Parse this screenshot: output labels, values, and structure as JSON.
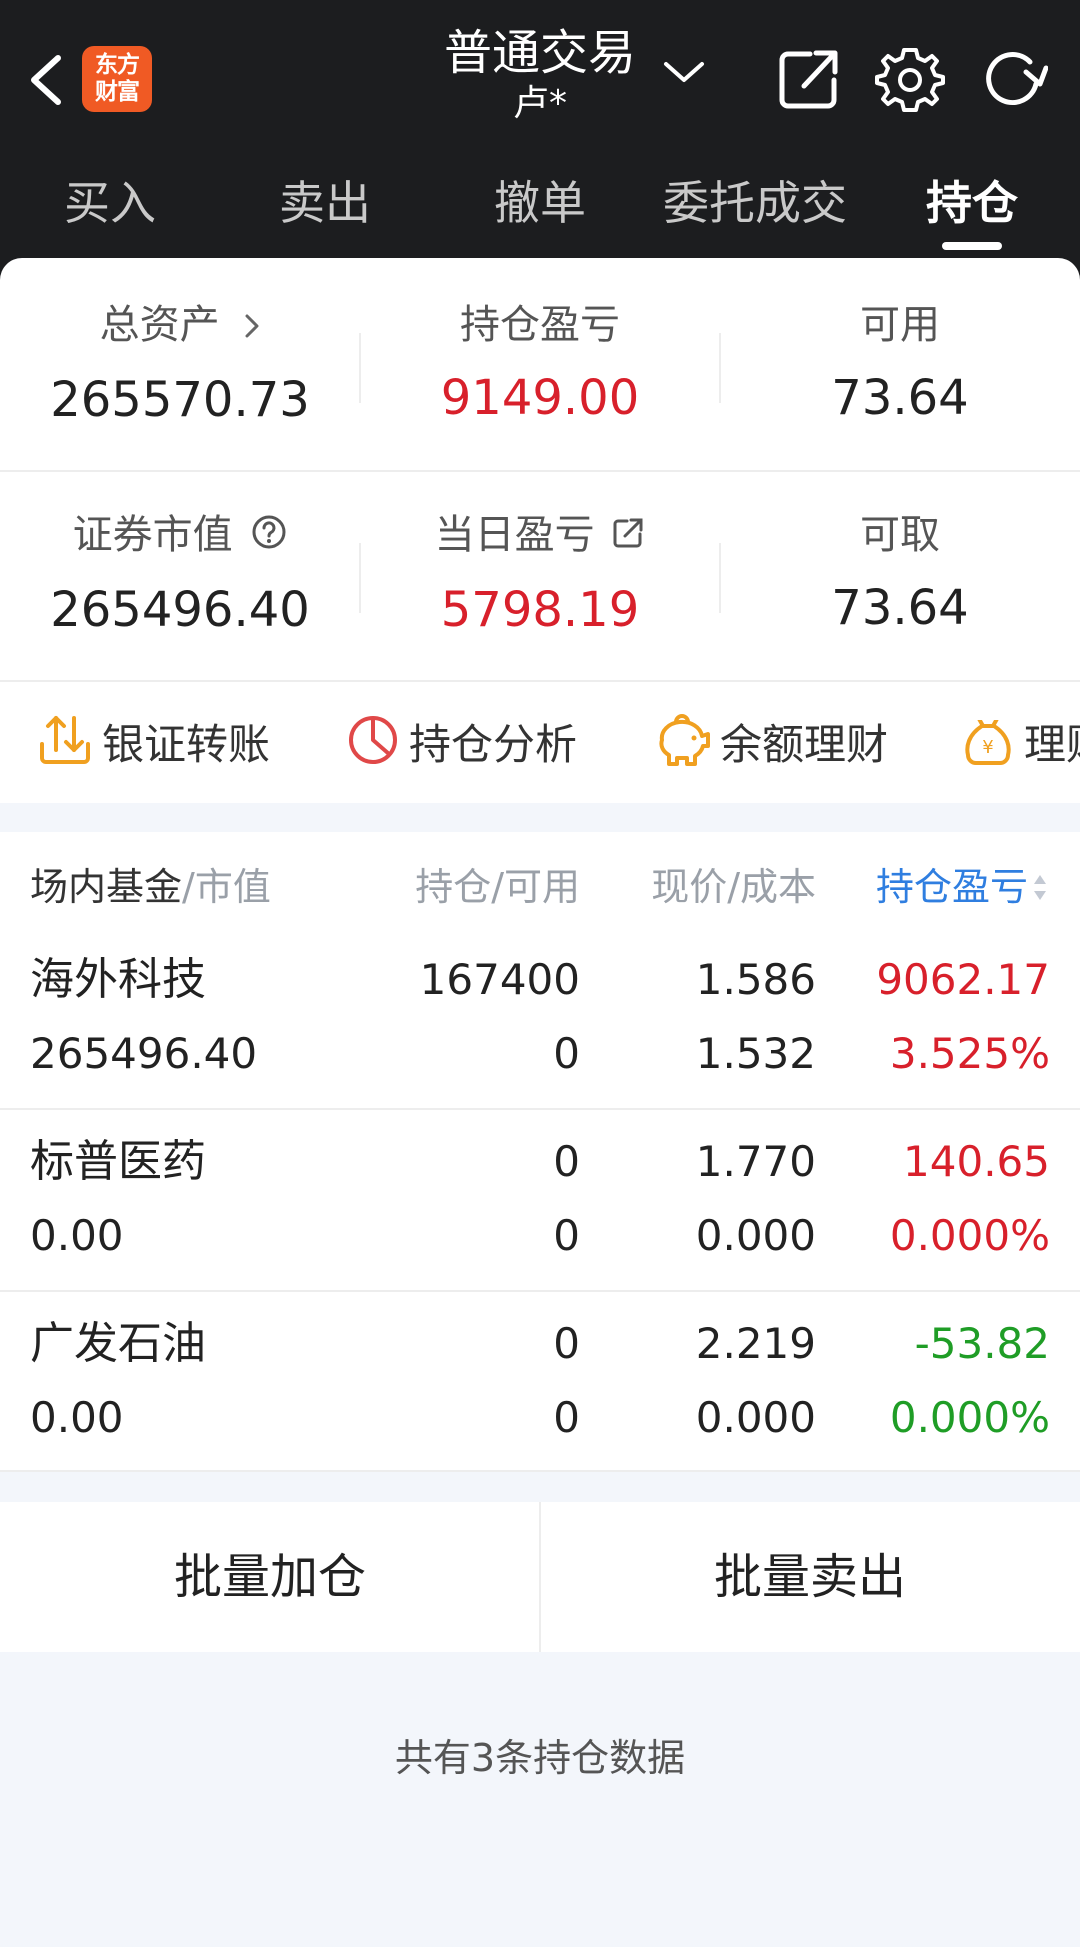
{
  "header": {
    "logo_text_line1": "东方",
    "logo_text_line2": "财富",
    "title": "普通交易",
    "subtitle": "卢*",
    "icons": [
      "back-arrow-icon",
      "share-external-icon",
      "gear-icon",
      "refresh-icon",
      "chevron-down-icon"
    ]
  },
  "tabs": [
    {
      "label": "买入",
      "active": false
    },
    {
      "label": "卖出",
      "active": false
    },
    {
      "label": "撤单",
      "active": false
    },
    {
      "label": "委托成交",
      "active": false
    },
    {
      "label": "持仓",
      "active": true
    }
  ],
  "summary": {
    "total_assets": {
      "label": "总资产",
      "value": "265570.73"
    },
    "position_pnl": {
      "label": "持仓盈亏",
      "value": "9149.00"
    },
    "available": {
      "label": "可用",
      "value": "73.64"
    },
    "market_value": {
      "label": "证券市值",
      "value": "265496.40"
    },
    "daily_pnl": {
      "label": "当日盈亏",
      "value": "5798.19"
    },
    "withdrawable": {
      "label": "可取",
      "value": "73.64"
    }
  },
  "quick_actions": [
    {
      "label": "银证转账",
      "icon": "transfer-icon"
    },
    {
      "label": "持仓分析",
      "icon": "pie-chart-icon"
    },
    {
      "label": "余额理财",
      "icon": "piggy-bank-icon"
    },
    {
      "label": "理财",
      "icon": "money-bag-icon"
    }
  ],
  "table": {
    "col1_primary": "场内基金",
    "col1_secondary": "/市值",
    "col2": "持仓/可用",
    "col3": "现价/成本",
    "col4": "持仓盈亏",
    "rows": [
      {
        "name": "海外科技",
        "market_value": "265496.40",
        "position": "167400",
        "available": "0",
        "price": "1.586",
        "cost": "1.532",
        "pnl": "9062.17",
        "pnl_pct": "3.525%",
        "color": "red"
      },
      {
        "name": "标普医药",
        "market_value": "0.00",
        "position": "0",
        "available": "0",
        "price": "1.770",
        "cost": "0.000",
        "pnl": "140.65",
        "pnl_pct": "0.000%",
        "color": "red"
      },
      {
        "name": "广发石油",
        "market_value": "0.00",
        "position": "0",
        "available": "0",
        "price": "2.219",
        "cost": "0.000",
        "pnl": "-53.82",
        "pnl_pct": "0.000%",
        "color": "green"
      }
    ]
  },
  "bottom": {
    "batch_add": "批量加仓",
    "batch_sell": "批量卖出"
  },
  "footer_note": "共有3条持仓数据",
  "colors": {
    "header_bg": "#1c1d1f",
    "logo_orange": "#f05a24",
    "red": "#d8202b",
    "green": "#1f9d26",
    "blue": "#2f7ee0",
    "accent_gold": "#f0a020"
  }
}
